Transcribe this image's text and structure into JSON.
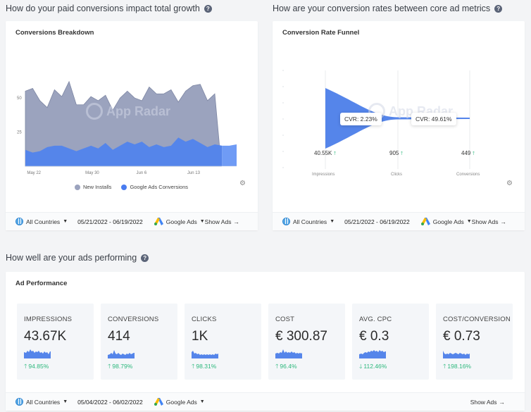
{
  "sections": {
    "growth_title": "How do your paid conversions impact total growth",
    "funnel_title": "How are your conversion rates between core ad metrics",
    "ads_title": "How well are your ads performing"
  },
  "help_icon": "?",
  "watermark": "App Radar",
  "conversions_card": {
    "title": "Conversions Breakdown",
    "footer": {
      "country": "All Countries",
      "date_range": "05/21/2022 - 06/19/2022",
      "source": "Google Ads",
      "show_ads": "Show Ads",
      "arrow": "→"
    }
  },
  "funnel_card": {
    "title": "Conversion Rate Funnel",
    "footer": {
      "country": "All Countries",
      "date_range": "05/21/2022 - 06/19/2022",
      "source": "Google Ads",
      "show_ads": "Show Ads",
      "arrow": "→"
    }
  },
  "ad_performance_card": {
    "title": "Ad Performance",
    "metrics": [
      {
        "label": "IMPRESSIONS",
        "value": "43.67K",
        "change": "94.85%",
        "direction": "up",
        "arrow": "🡑"
      },
      {
        "label": "CONVERSIONS",
        "value": "414",
        "change": "98.79%",
        "direction": "up",
        "arrow": "🡑"
      },
      {
        "label": "CLICKS",
        "value": "1K",
        "change": "98.31%",
        "direction": "up",
        "arrow": "🡑"
      },
      {
        "label": "COST",
        "value": "€ 300.87",
        "change": "96.4%",
        "direction": "up",
        "arrow": "🡑"
      },
      {
        "label": "AVG. CPC",
        "value": "€ 0.3",
        "change": "112.46%",
        "direction": "down",
        "arrow": "🡓"
      },
      {
        "label": "COST/CONVERSION",
        "value": "€ 0.73",
        "change": "198.16%",
        "direction": "up",
        "arrow": "🡑"
      }
    ],
    "footer": {
      "country": "All Countries",
      "date_range": "05/04/2022 - 06/02/2022",
      "source": "Google Ads",
      "show_ads": "Show Ads",
      "arrow": "→"
    }
  },
  "colors": {
    "installs": "#9ba3be",
    "conversions": "#5585ea",
    "conversions_projection": "#6f9bf5",
    "positive": "#2db87d",
    "funnel": "#5585ea"
  },
  "chart_data": [
    {
      "type": "area",
      "title": "Conversions Breakdown",
      "stacked": false,
      "xlabel": "",
      "ylabel": "",
      "ylim": [
        0,
        65
      ],
      "yticks": [
        25,
        50
      ],
      "x_tick_labels": [
        "May 22",
        "May 30",
        "Jun 6",
        "Jun 13"
      ],
      "x": [
        "May 21",
        "May 22",
        "May 23",
        "May 24",
        "May 25",
        "May 26",
        "May 27",
        "May 28",
        "May 29",
        "May 30",
        "May 31",
        "Jun 1",
        "Jun 2",
        "Jun 3",
        "Jun 4",
        "Jun 5",
        "Jun 6",
        "Jun 7",
        "Jun 8",
        "Jun 9",
        "Jun 10",
        "Jun 11",
        "Jun 12",
        "Jun 13",
        "Jun 14",
        "Jun 15",
        "Jun 16",
        "Jun 17",
        "Jun 18",
        "Jun 19"
      ],
      "series": [
        {
          "name": "New Installs",
          "values": [
            55,
            57,
            48,
            43,
            56,
            51,
            62,
            45,
            45,
            51,
            48,
            52,
            41,
            50,
            55,
            50,
            48,
            58,
            53,
            53,
            56,
            47,
            55,
            59,
            60,
            48,
            53,
            0,
            0,
            0
          ]
        },
        {
          "name": "Google Ads Conversions",
          "values": [
            12,
            10,
            11,
            14,
            15,
            15,
            13,
            11,
            13,
            15,
            13,
            17,
            12,
            15,
            18,
            16,
            18,
            14,
            16,
            14,
            15,
            21,
            18,
            20,
            17,
            14,
            16,
            15,
            15,
            16
          ]
        }
      ],
      "legend": [
        "New Installs",
        "Google Ads Conversions"
      ],
      "legend_position": "bottom"
    },
    {
      "type": "funnel",
      "title": "Conversion Rate Funnel",
      "categories": [
        "Impressions",
        "Clicks",
        "Conversions"
      ],
      "values": [
        "40.55K",
        "905",
        "449"
      ],
      "value_numbers": [
        40550,
        905,
        449
      ],
      "conversion_rates": [
        "CVR: 2.23%",
        "CVR: 49.61%"
      ],
      "trend": [
        "up",
        "up",
        "up"
      ]
    }
  ]
}
